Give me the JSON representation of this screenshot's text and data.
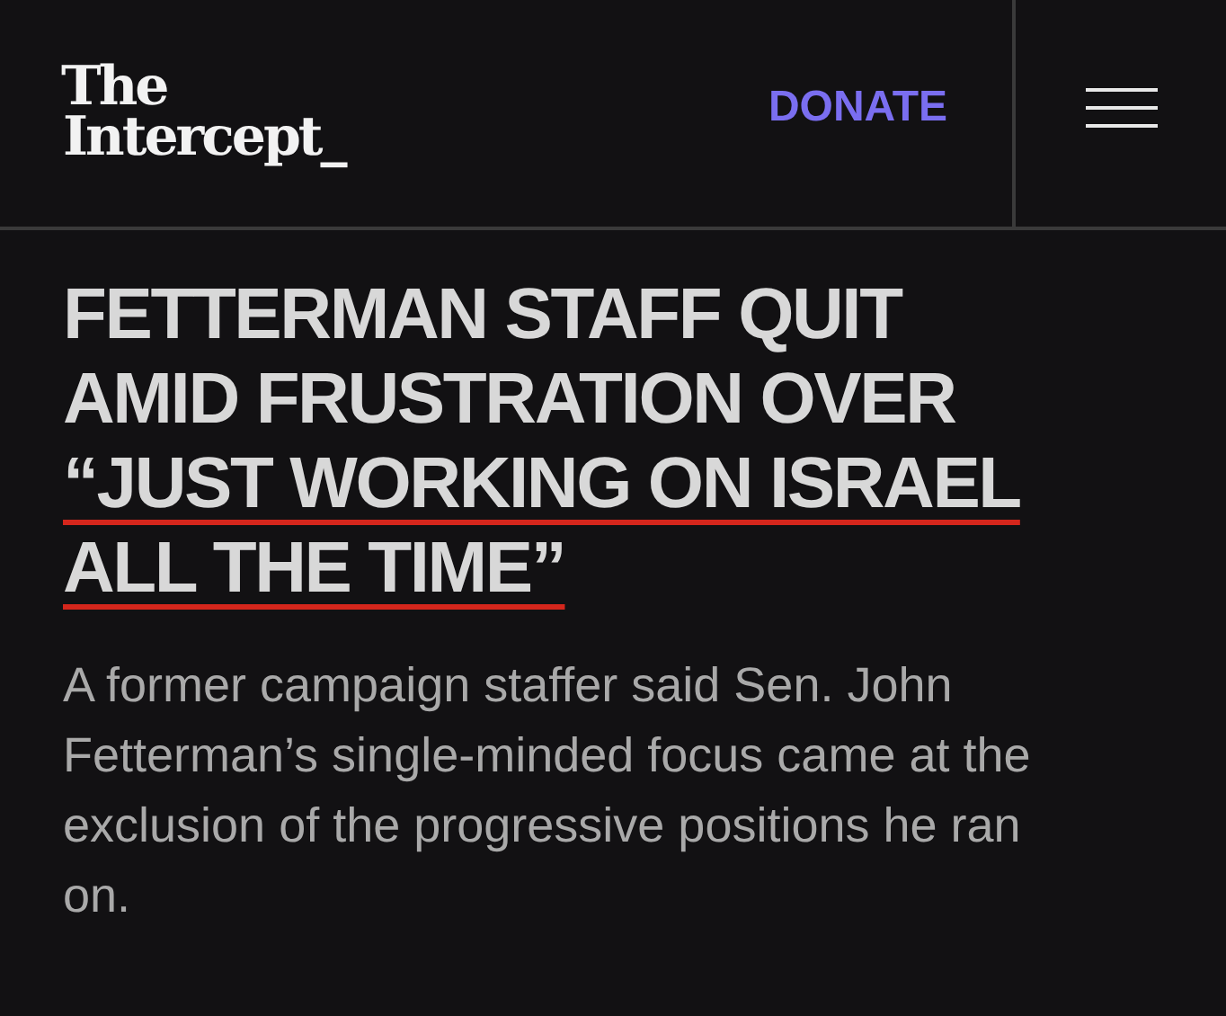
{
  "header": {
    "logo_lines": [
      "The",
      "Intercept_"
    ],
    "donate": "DONATE"
  },
  "headline": [
    {
      "text": "FETTERMAN STAFF QUIT",
      "underlined": false
    },
    {
      "text": "AMID FRUSTRATION OVER",
      "underlined": false
    },
    {
      "text": "“JUST WORKING ON ISRAEL",
      "underlined": true
    },
    {
      "text": "ALL THE TIME”",
      "underlined": true
    }
  ],
  "dek": "A former campaign staffer said Sen. John Fetterman’s single-minded focus came at the exclusion of the progressive positions he ran on."
}
